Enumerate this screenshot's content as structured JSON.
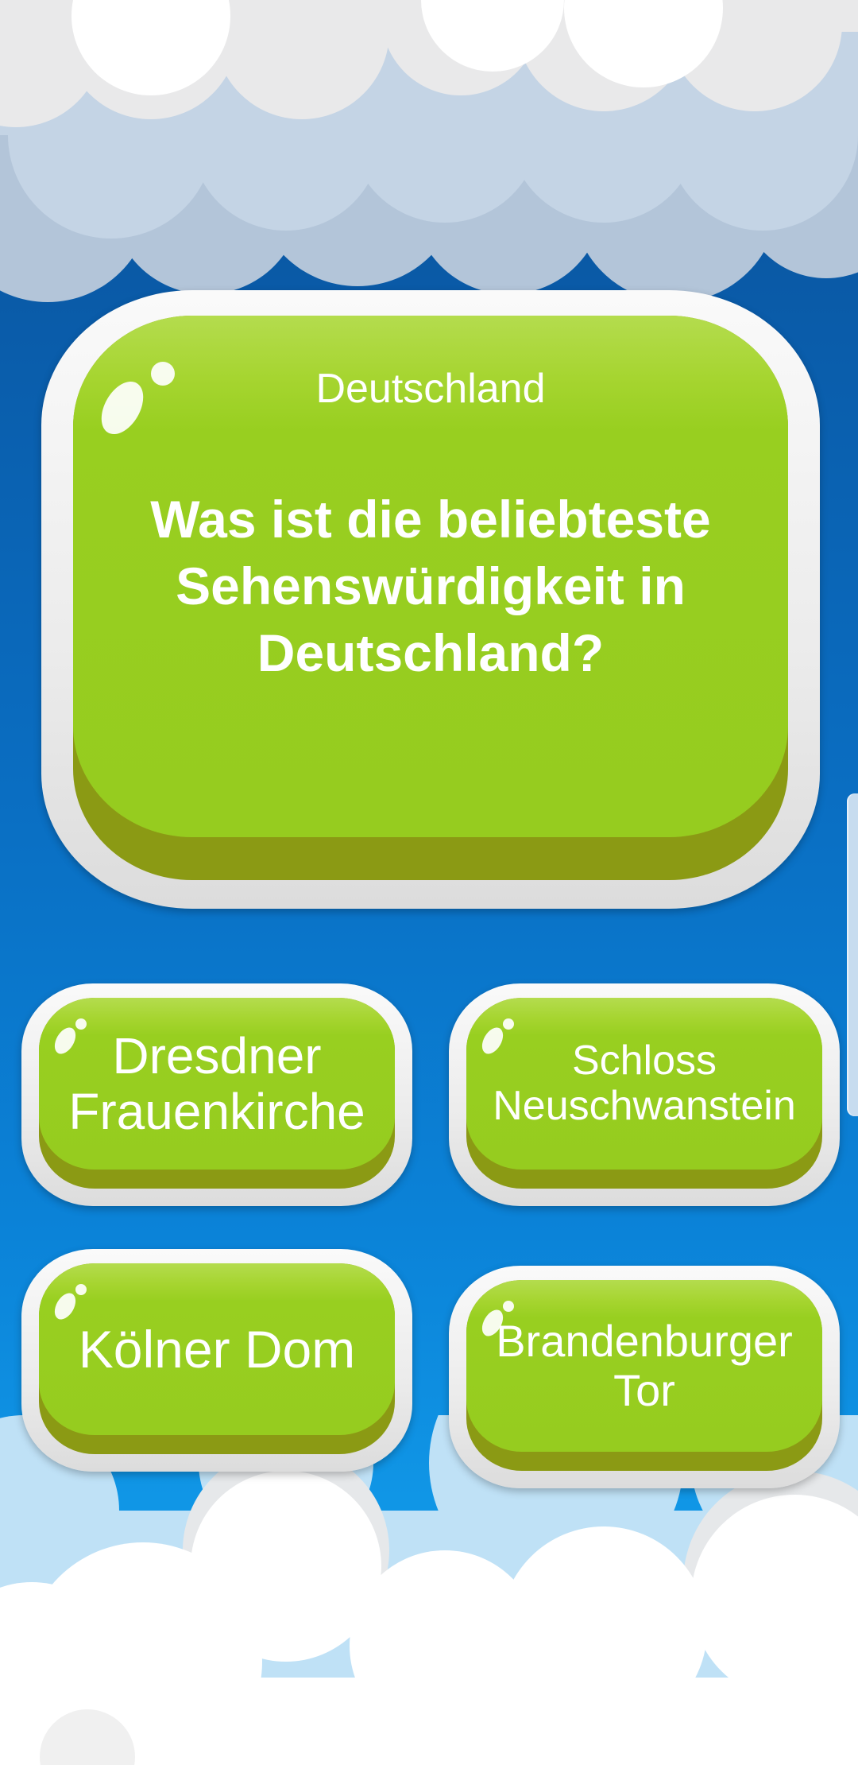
{
  "question": {
    "category": "Deutschland",
    "text": "Was ist die beliebteste Sehenswürdigkeit in Deutschland?"
  },
  "answers": [
    {
      "label": "Dresdner Frauenkirche"
    },
    {
      "label": "Schloss Neuschwanstein"
    },
    {
      "label": "Kölner Dom"
    },
    {
      "label": "Brandenburger Tor"
    }
  ],
  "colors": {
    "button_green": "#96cc1f",
    "button_shadow": "#8b9a14",
    "frame": "#ebebeb",
    "sky_top": "#0a4f97",
    "sky_bottom": "#1a9ce8",
    "text": "#ffffff"
  }
}
